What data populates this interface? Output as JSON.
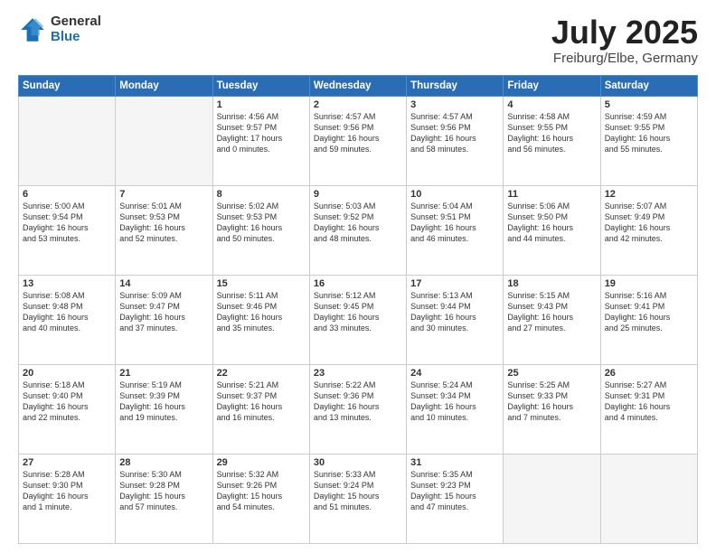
{
  "header": {
    "logo_general": "General",
    "logo_blue": "Blue",
    "title": "July 2025",
    "location": "Freiburg/Elbe, Germany"
  },
  "weekdays": [
    "Sunday",
    "Monday",
    "Tuesday",
    "Wednesday",
    "Thursday",
    "Friday",
    "Saturday"
  ],
  "weeks": [
    [
      {
        "day": "",
        "lines": []
      },
      {
        "day": "",
        "lines": []
      },
      {
        "day": "1",
        "lines": [
          "Sunrise: 4:56 AM",
          "Sunset: 9:57 PM",
          "Daylight: 17 hours",
          "and 0 minutes."
        ]
      },
      {
        "day": "2",
        "lines": [
          "Sunrise: 4:57 AM",
          "Sunset: 9:56 PM",
          "Daylight: 16 hours",
          "and 59 minutes."
        ]
      },
      {
        "day": "3",
        "lines": [
          "Sunrise: 4:57 AM",
          "Sunset: 9:56 PM",
          "Daylight: 16 hours",
          "and 58 minutes."
        ]
      },
      {
        "day": "4",
        "lines": [
          "Sunrise: 4:58 AM",
          "Sunset: 9:55 PM",
          "Daylight: 16 hours",
          "and 56 minutes."
        ]
      },
      {
        "day": "5",
        "lines": [
          "Sunrise: 4:59 AM",
          "Sunset: 9:55 PM",
          "Daylight: 16 hours",
          "and 55 minutes."
        ]
      }
    ],
    [
      {
        "day": "6",
        "lines": [
          "Sunrise: 5:00 AM",
          "Sunset: 9:54 PM",
          "Daylight: 16 hours",
          "and 53 minutes."
        ]
      },
      {
        "day": "7",
        "lines": [
          "Sunrise: 5:01 AM",
          "Sunset: 9:53 PM",
          "Daylight: 16 hours",
          "and 52 minutes."
        ]
      },
      {
        "day": "8",
        "lines": [
          "Sunrise: 5:02 AM",
          "Sunset: 9:53 PM",
          "Daylight: 16 hours",
          "and 50 minutes."
        ]
      },
      {
        "day": "9",
        "lines": [
          "Sunrise: 5:03 AM",
          "Sunset: 9:52 PM",
          "Daylight: 16 hours",
          "and 48 minutes."
        ]
      },
      {
        "day": "10",
        "lines": [
          "Sunrise: 5:04 AM",
          "Sunset: 9:51 PM",
          "Daylight: 16 hours",
          "and 46 minutes."
        ]
      },
      {
        "day": "11",
        "lines": [
          "Sunrise: 5:06 AM",
          "Sunset: 9:50 PM",
          "Daylight: 16 hours",
          "and 44 minutes."
        ]
      },
      {
        "day": "12",
        "lines": [
          "Sunrise: 5:07 AM",
          "Sunset: 9:49 PM",
          "Daylight: 16 hours",
          "and 42 minutes."
        ]
      }
    ],
    [
      {
        "day": "13",
        "lines": [
          "Sunrise: 5:08 AM",
          "Sunset: 9:48 PM",
          "Daylight: 16 hours",
          "and 40 minutes."
        ]
      },
      {
        "day": "14",
        "lines": [
          "Sunrise: 5:09 AM",
          "Sunset: 9:47 PM",
          "Daylight: 16 hours",
          "and 37 minutes."
        ]
      },
      {
        "day": "15",
        "lines": [
          "Sunrise: 5:11 AM",
          "Sunset: 9:46 PM",
          "Daylight: 16 hours",
          "and 35 minutes."
        ]
      },
      {
        "day": "16",
        "lines": [
          "Sunrise: 5:12 AM",
          "Sunset: 9:45 PM",
          "Daylight: 16 hours",
          "and 33 minutes."
        ]
      },
      {
        "day": "17",
        "lines": [
          "Sunrise: 5:13 AM",
          "Sunset: 9:44 PM",
          "Daylight: 16 hours",
          "and 30 minutes."
        ]
      },
      {
        "day": "18",
        "lines": [
          "Sunrise: 5:15 AM",
          "Sunset: 9:43 PM",
          "Daylight: 16 hours",
          "and 27 minutes."
        ]
      },
      {
        "day": "19",
        "lines": [
          "Sunrise: 5:16 AM",
          "Sunset: 9:41 PM",
          "Daylight: 16 hours",
          "and 25 minutes."
        ]
      }
    ],
    [
      {
        "day": "20",
        "lines": [
          "Sunrise: 5:18 AM",
          "Sunset: 9:40 PM",
          "Daylight: 16 hours",
          "and 22 minutes."
        ]
      },
      {
        "day": "21",
        "lines": [
          "Sunrise: 5:19 AM",
          "Sunset: 9:39 PM",
          "Daylight: 16 hours",
          "and 19 minutes."
        ]
      },
      {
        "day": "22",
        "lines": [
          "Sunrise: 5:21 AM",
          "Sunset: 9:37 PM",
          "Daylight: 16 hours",
          "and 16 minutes."
        ]
      },
      {
        "day": "23",
        "lines": [
          "Sunrise: 5:22 AM",
          "Sunset: 9:36 PM",
          "Daylight: 16 hours",
          "and 13 minutes."
        ]
      },
      {
        "day": "24",
        "lines": [
          "Sunrise: 5:24 AM",
          "Sunset: 9:34 PM",
          "Daylight: 16 hours",
          "and 10 minutes."
        ]
      },
      {
        "day": "25",
        "lines": [
          "Sunrise: 5:25 AM",
          "Sunset: 9:33 PM",
          "Daylight: 16 hours",
          "and 7 minutes."
        ]
      },
      {
        "day": "26",
        "lines": [
          "Sunrise: 5:27 AM",
          "Sunset: 9:31 PM",
          "Daylight: 16 hours",
          "and 4 minutes."
        ]
      }
    ],
    [
      {
        "day": "27",
        "lines": [
          "Sunrise: 5:28 AM",
          "Sunset: 9:30 PM",
          "Daylight: 16 hours",
          "and 1 minute."
        ]
      },
      {
        "day": "28",
        "lines": [
          "Sunrise: 5:30 AM",
          "Sunset: 9:28 PM",
          "Daylight: 15 hours",
          "and 57 minutes."
        ]
      },
      {
        "day": "29",
        "lines": [
          "Sunrise: 5:32 AM",
          "Sunset: 9:26 PM",
          "Daylight: 15 hours",
          "and 54 minutes."
        ]
      },
      {
        "day": "30",
        "lines": [
          "Sunrise: 5:33 AM",
          "Sunset: 9:24 PM",
          "Daylight: 15 hours",
          "and 51 minutes."
        ]
      },
      {
        "day": "31",
        "lines": [
          "Sunrise: 5:35 AM",
          "Sunset: 9:23 PM",
          "Daylight: 15 hours",
          "and 47 minutes."
        ]
      },
      {
        "day": "",
        "lines": []
      },
      {
        "day": "",
        "lines": []
      }
    ]
  ]
}
